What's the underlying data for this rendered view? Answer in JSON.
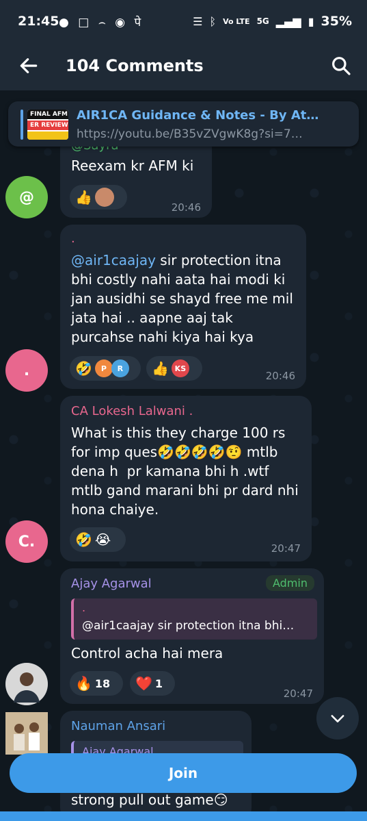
{
  "status_bar": {
    "time": "21:45",
    "notification_icons": [
      "messages-icon",
      "instagram-icon",
      "amazon-icon",
      "app-icon",
      "phonepe-icon"
    ],
    "notification_glyphs": "● □ ⌢ ◉ पे",
    "network": "Vo LTE",
    "signal": "5G",
    "battery": "35%"
  },
  "app_bar": {
    "title": "104 Comments"
  },
  "pinned": {
    "title": "AIR1CA Guidance & Notes - By Atul…",
    "url": "https://youtu.be/B35vZVgwK8g?si=7…",
    "thumb_line1": "FINAL AFM",
    "thumb_line2": "ER REVIEW"
  },
  "messages": [
    {
      "sender": "@Sayra",
      "text": "Reexam kr AFM ki",
      "time": "20:46",
      "avatar_letter": "@",
      "reactions": [
        "👍"
      ]
    },
    {
      "sender": ".",
      "mention": "@air1caajay",
      "text": " sir protection itna bhi costly nahi aata hai modi ki jan ausidhi se shayd free me mil jata hai .. aapne aaj tak purcahse nahi kiya hai kya",
      "time": "20:46",
      "avatar_letter": ".",
      "reaction1_emoji": "🤣",
      "reaction1_avatars": [
        "P",
        "R"
      ],
      "reaction2_emoji": "👍",
      "reaction2_avatars": [
        "KS"
      ]
    },
    {
      "sender": "CA Lokesh Lalwani .",
      "text": "What is this they charge 100 rs for imp ques🤣🤣🤣🤣🤨 mtlb dena h  pr kamana bhi h .wtf mtlb gand marani bhi pr dard nhi hona chaiye.",
      "time": "20:47",
      "avatar_letter": "C.",
      "reactions": [
        "🤣",
        "😭"
      ]
    },
    {
      "sender": "Ajay Agarwal",
      "badge": "Admin",
      "reply_sender": ".",
      "reply_text": "@air1caajay sir protection itna bhi…",
      "text": "Control acha hai mera",
      "time": "20:47",
      "reaction1_emoji": "🔥",
      "reaction1_count": "18",
      "reaction2_emoji": "❤️",
      "reaction2_count": "1"
    },
    {
      "sender": "Nauman Ansari",
      "reply_sender": "Ajay Agarwal",
      "text": "strong pull out game😏"
    }
  ],
  "join_button": "Join",
  "colors": {
    "accent": "#3d9ae8",
    "bubble": "#1d2733",
    "background": "#10181f"
  }
}
